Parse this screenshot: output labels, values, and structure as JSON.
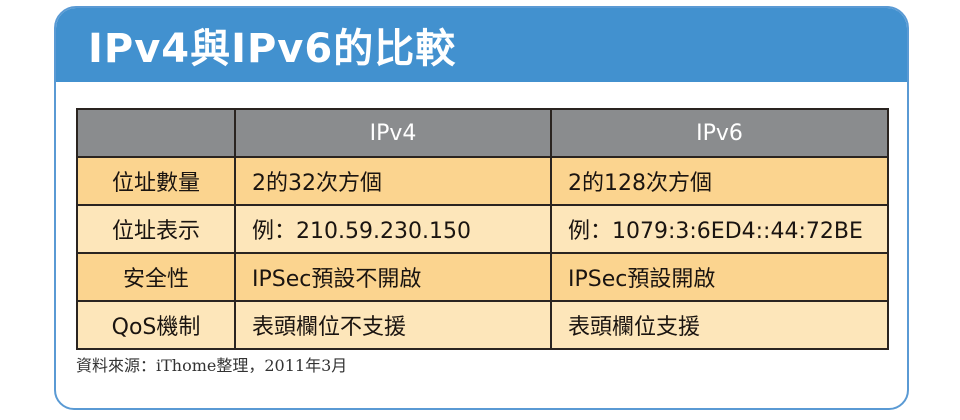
{
  "title": "IPv4與IPv6的比較",
  "colors": {
    "banner": "#4291cf",
    "header_row": "#8a8c8e",
    "row_dark": "#fbd48f",
    "row_light": "#fde6ba"
  },
  "table": {
    "headers": [
      "",
      "IPv4",
      "IPv6"
    ],
    "rows": [
      [
        "位址數量",
        "2的32次方個",
        "2的128次方個"
      ],
      [
        "位址表示",
        "例：210.59.230.150",
        "例：1079:3:6ED4::44:72BE"
      ],
      [
        "安全性",
        "IPSec預設不開啟",
        "IPSec預設開啟"
      ],
      [
        "QoS機制",
        "表頭欄位不支援",
        "表頭欄位支援"
      ]
    ]
  },
  "source": "資料來源：iThome整理，2011年3月"
}
